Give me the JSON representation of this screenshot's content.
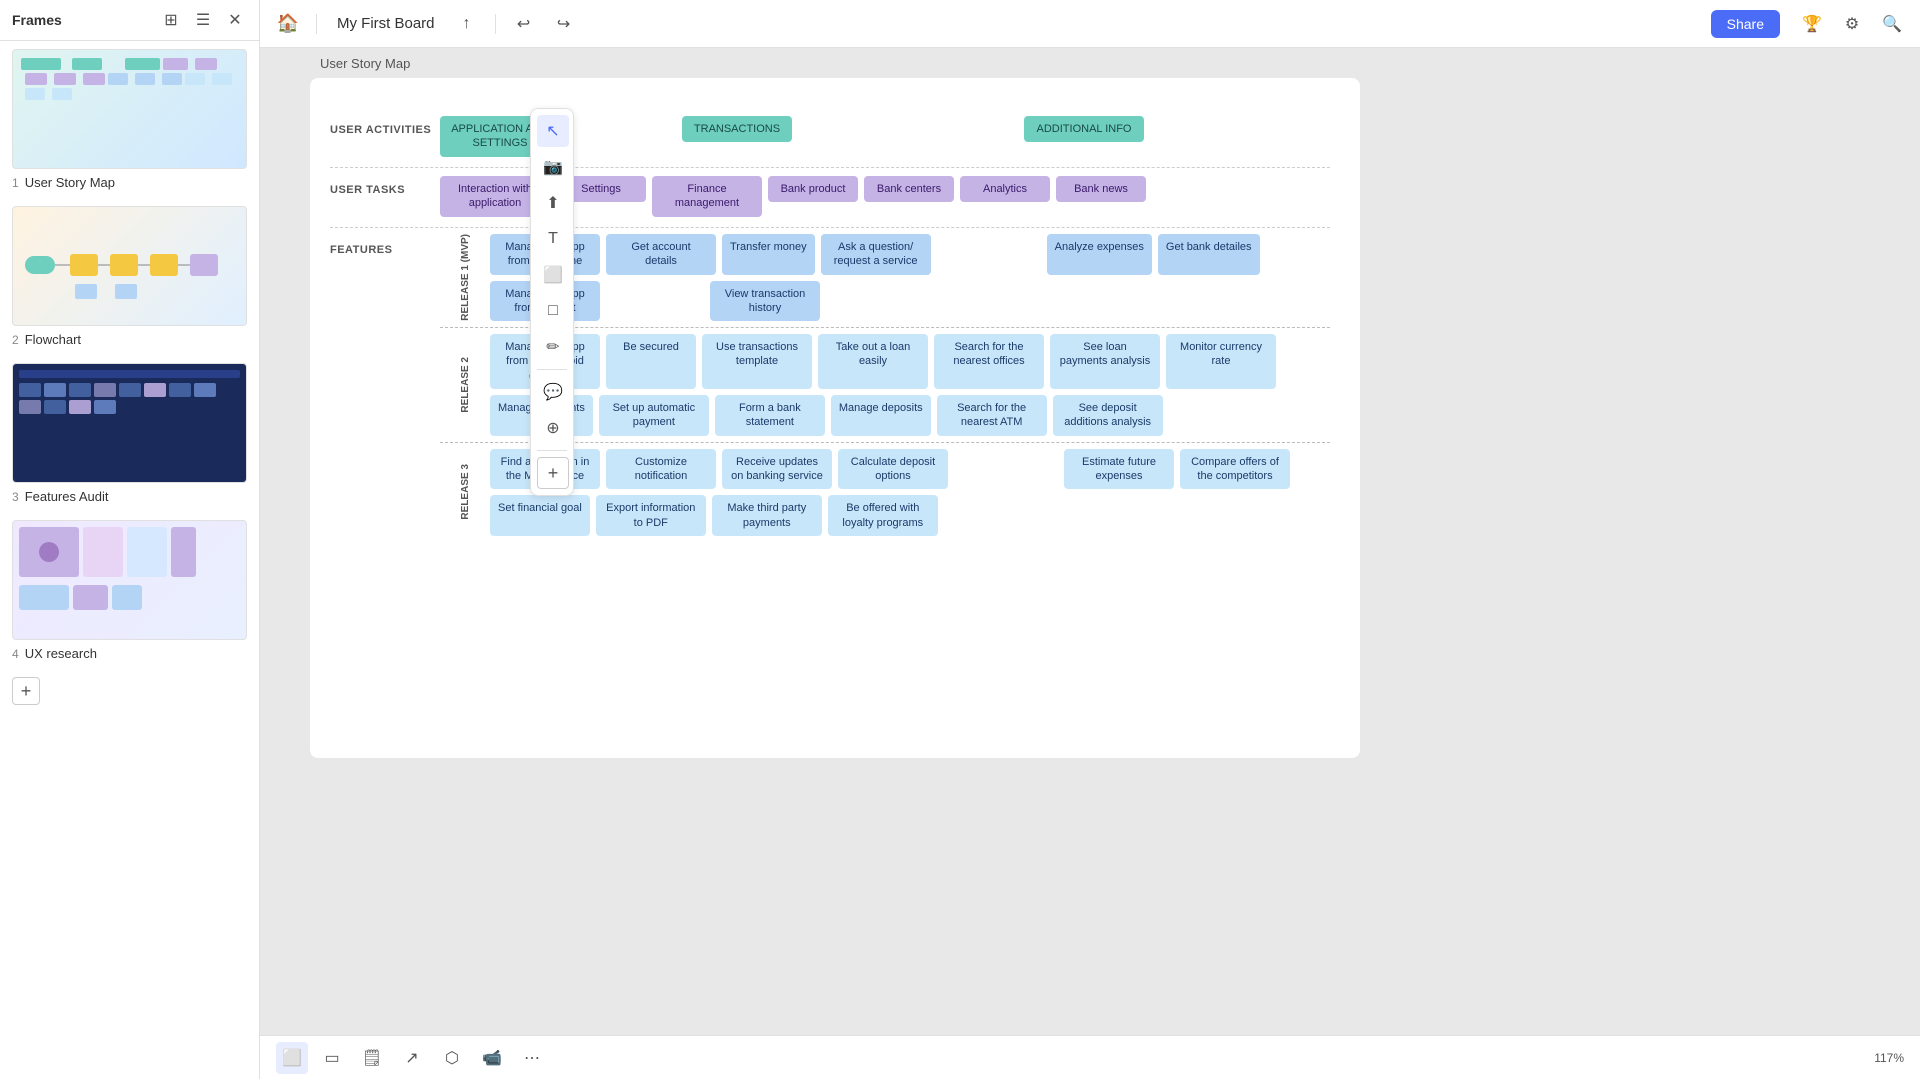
{
  "app": {
    "title": "Frames",
    "board_name": "My First Board",
    "share_label": "Share"
  },
  "sidebar": {
    "frames": [
      {
        "number": "1",
        "label": "User Story Map",
        "thumb_type": "usm"
      },
      {
        "number": "2",
        "label": "Flowchart",
        "thumb_type": "flow"
      },
      {
        "number": "3",
        "label": "Features Audit",
        "thumb_type": "fa"
      },
      {
        "number": "4",
        "label": "UX research",
        "thumb_type": "ux"
      }
    ]
  },
  "canvas": {
    "frame_label": "User Story Map"
  },
  "board": {
    "row_labels": {
      "user_activities": "USER ACTIVITIES",
      "user_tasks": "USER TASKS",
      "features": "FEATURES"
    },
    "activities": [
      {
        "label": "APPLICATION AND SETTINGS",
        "color": "teal"
      },
      {
        "label": "TRANSACTIONS",
        "color": "teal"
      },
      {
        "label": "ADDITIONAL INFO",
        "color": "teal"
      }
    ],
    "user_tasks": [
      {
        "label": "Interaction with application",
        "color": "purple"
      },
      {
        "label": "Settings",
        "color": "purple"
      },
      {
        "label": "Finance management",
        "color": "purple"
      },
      {
        "label": "Bank product",
        "color": "purple"
      },
      {
        "label": "Bank centers",
        "color": "purple"
      },
      {
        "label": "Analytics",
        "color": "purple"
      },
      {
        "label": "Bank news",
        "color": "purple"
      }
    ],
    "release1": {
      "label": "Release 1 (MVP)",
      "rows": [
        [
          {
            "label": "Manage the app from an iPhone",
            "color": "blue"
          },
          {
            "label": "Get account details",
            "color": "blue"
          },
          {
            "label": "Transfer money",
            "color": "blue"
          },
          {
            "label": "Ask a question/ request a service",
            "color": "blue"
          },
          {
            "label": "Analyze expenses",
            "color": "blue"
          },
          {
            "label": "Get bank detailes",
            "color": "blue"
          }
        ],
        [
          {
            "label": "Manage the app from a tablet",
            "color": "blue"
          },
          {
            "label": "View transaction history",
            "color": "blue"
          }
        ]
      ]
    },
    "release2": {
      "label": "Release 2",
      "rows": [
        [
          {
            "label": "Manage the app from an Android device",
            "color": "light-blue"
          },
          {
            "label": "Be secured",
            "color": "light-blue"
          },
          {
            "label": "Use transactions template",
            "color": "light-blue"
          },
          {
            "label": "Take out a loan easily",
            "color": "light-blue"
          },
          {
            "label": "Search for the nearest offices",
            "color": "light-blue"
          },
          {
            "label": "See loan payments analysis",
            "color": "light-blue"
          },
          {
            "label": "Monitor currency rate",
            "color": "light-blue"
          }
        ],
        [
          {
            "label": "Manage accounts",
            "color": "light-blue"
          },
          {
            "label": "Set up automatic payment",
            "color": "light-blue"
          },
          {
            "label": "Form a bank statement",
            "color": "light-blue"
          },
          {
            "label": "Manage deposits",
            "color": "light-blue"
          },
          {
            "label": "Search for the nearest ATM",
            "color": "light-blue"
          },
          {
            "label": "See deposit additions analysis",
            "color": "light-blue"
          }
        ]
      ]
    },
    "release3": {
      "label": "Release 3",
      "rows": [
        [
          {
            "label": "Find application in the Marketplace",
            "color": "light-blue"
          },
          {
            "label": "Customize notification",
            "color": "light-blue"
          },
          {
            "label": "Receive updates on banking service",
            "color": "light-blue"
          },
          {
            "label": "Calculate deposit options",
            "color": "light-blue"
          },
          {
            "label": "Estimate future expenses",
            "color": "light-blue"
          },
          {
            "label": "Compare offers of the competitors",
            "color": "light-blue"
          }
        ],
        [
          {
            "label": "Set financial goal",
            "color": "light-blue"
          },
          {
            "label": "Export information to PDF",
            "color": "light-blue"
          },
          {
            "label": "Make third party payments",
            "color": "light-blue"
          },
          {
            "label": "Be offered with loyalty programs",
            "color": "light-blue"
          }
        ]
      ]
    }
  },
  "zoom": "117%",
  "toolbar": {
    "tools": [
      "cursor",
      "camera",
      "upload",
      "text",
      "frame",
      "rect",
      "pencil",
      "comment",
      "transform"
    ],
    "bottom_tools": [
      "select",
      "frame-tool",
      "sticky",
      "connector",
      "export",
      "camera-bottom",
      "more"
    ]
  }
}
